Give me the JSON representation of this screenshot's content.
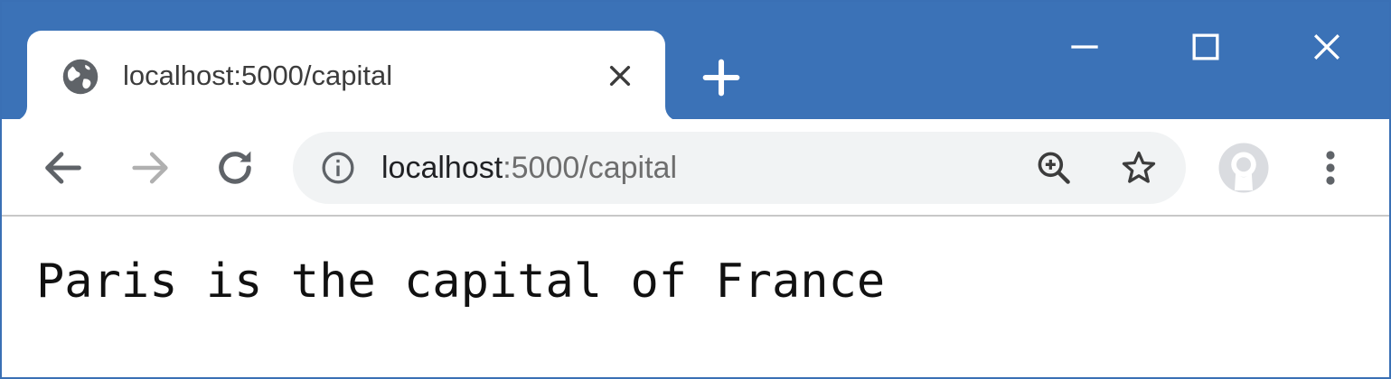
{
  "tab": {
    "title": "localhost:5000/capital",
    "favicon_icon": "globe-icon",
    "close_icon": "close-icon"
  },
  "new_tab": {
    "icon": "plus-icon"
  },
  "window_controls": {
    "minimize_icon": "minimize-icon",
    "maximize_icon": "maximize-icon",
    "close_icon": "close-icon"
  },
  "toolbar": {
    "back_icon": "arrow-left-icon",
    "forward_icon": "arrow-right-icon",
    "reload_icon": "reload-icon",
    "site_info_icon": "info-icon",
    "zoom_icon": "zoom-in-icon",
    "bookmark_icon": "star-icon",
    "profile_icon": "avatar-icon",
    "menu_icon": "kebab-menu-icon"
  },
  "address_bar": {
    "host": "localhost",
    "path": ":5000/capital"
  },
  "page": {
    "body_text": "Paris is the capital of France"
  },
  "colors": {
    "titlebar": "#3b72b7",
    "omnibox_bg": "#f1f3f4",
    "icon_dark": "#5f6368",
    "icon_disabled": "#b0b0b0"
  }
}
